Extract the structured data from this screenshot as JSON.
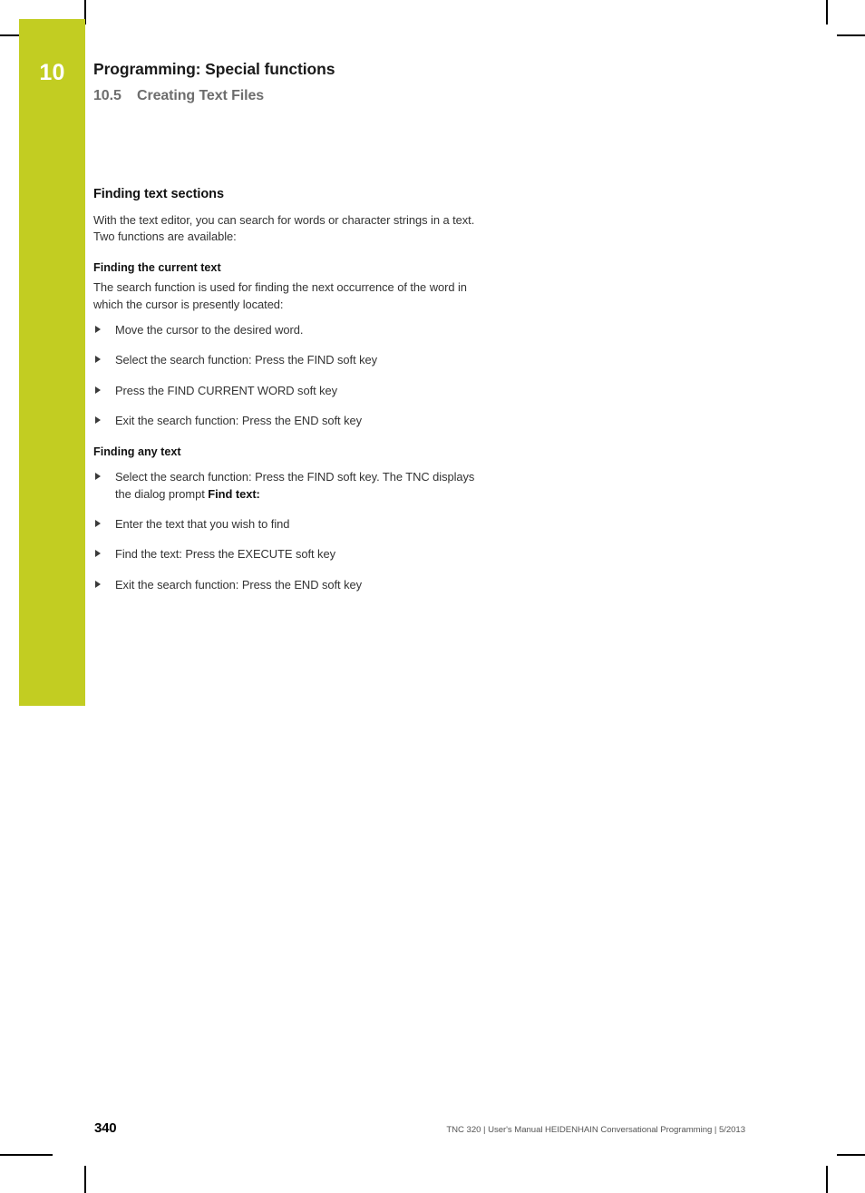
{
  "document": {
    "chapter_number": "10",
    "running_head": {
      "title": "Programming: Special functions",
      "section_number": "10.5",
      "section_title": "Creating Text Files"
    }
  },
  "content": {
    "heading": "Finding text sections",
    "intro": "With the text editor, you can search for words or character strings in a text. Two functions are available:",
    "blocks": [
      {
        "subheading": "Finding the current text",
        "paragraph": "The search function is used for finding the next occurrence of the word in which the cursor is presently located:",
        "steps": [
          {
            "text": "Move the cursor to the desired word."
          },
          {
            "text": "Select the search function: Press the FIND soft key"
          },
          {
            "text": "Press the FIND CURRENT WORD soft key"
          },
          {
            "text": "Exit the search function: Press the END soft key"
          }
        ]
      },
      {
        "subheading": "Finding any text",
        "paragraph": "",
        "steps": [
          {
            "text": "Select the search function: Press the FIND soft key. The TNC displays the dialog prompt ",
            "bold_tail": "Find text:"
          },
          {
            "text": "Enter the text that you wish to find"
          },
          {
            "text": "Find the text: Press the EXECUTE soft key"
          },
          {
            "text": "Exit the search function: Press the END soft key"
          }
        ]
      }
    ]
  },
  "footer": {
    "page_number": "340",
    "imprint": "TNC 320 | User's Manual HEIDENHAIN Conversational Programming | 5/2013"
  },
  "colors": {
    "chapter_tab": "#c2cd22",
    "heading": "#111111",
    "body_text": "#333333",
    "running_head_sub": "#6d6d6d",
    "crop_mark": "#000000"
  }
}
